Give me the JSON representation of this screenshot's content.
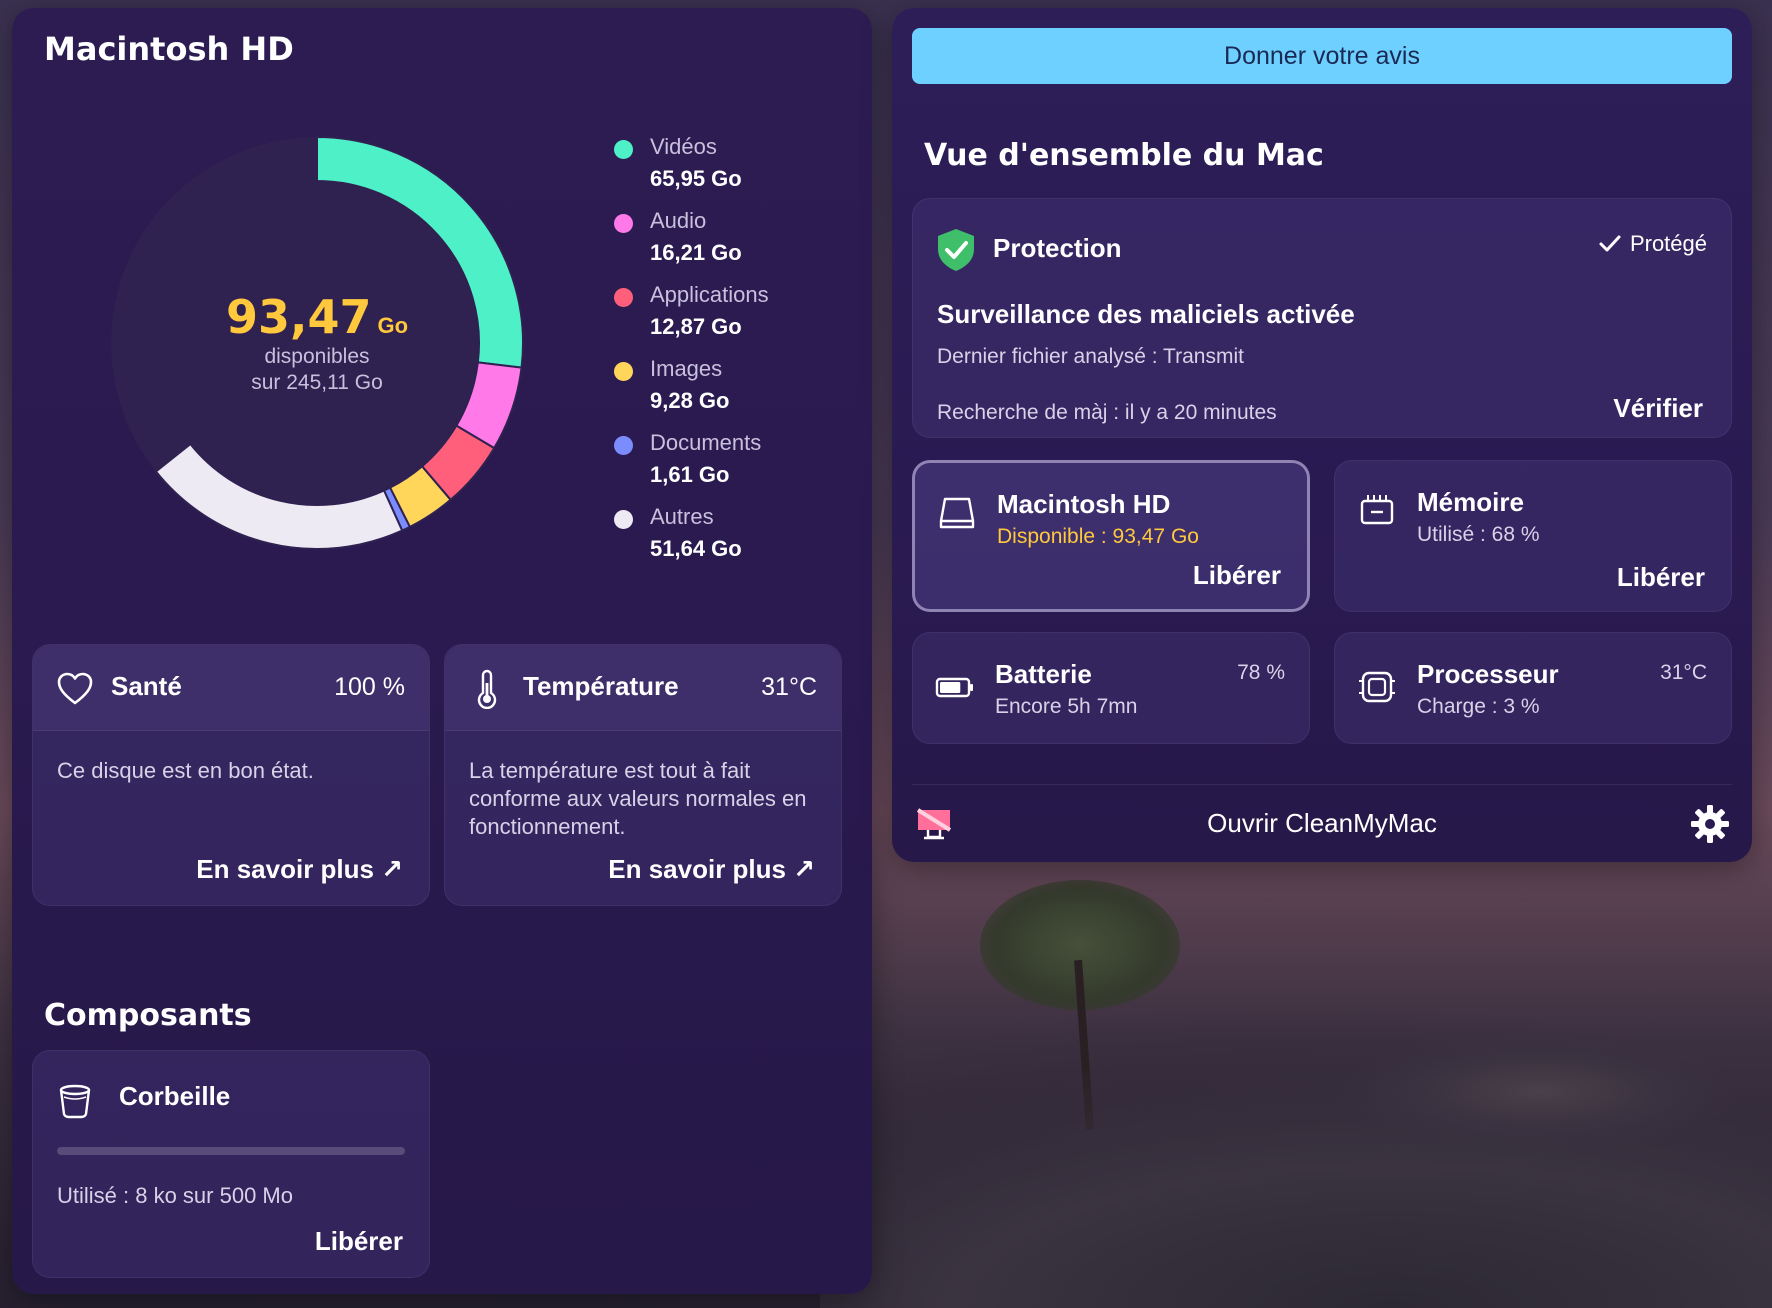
{
  "left": {
    "disk_title": "Macintosh HD",
    "donut": {
      "free_value": "93,47",
      "free_unit": "Go",
      "free_label": "disponibles",
      "total_label": "sur 245,11 Go",
      "total_gb": 245.11,
      "free_gb": 93.47
    },
    "legend": [
      {
        "name": "Vidéos",
        "size": "65,95 Go",
        "gb": 65.95,
        "color": "#4ef0c8"
      },
      {
        "name": "Audio",
        "size": "16,21 Go",
        "gb": 16.21,
        "color": "#ff7ae8"
      },
      {
        "name": "Applications",
        "size": "12,87 Go",
        "gb": 12.87,
        "color": "#ff5f7a"
      },
      {
        "name": "Images",
        "size": "9,28 Go",
        "gb": 9.28,
        "color": "#ffd65a"
      },
      {
        "name": "Documents",
        "size": "1,61 Go",
        "gb": 1.61,
        "color": "#7b8cff"
      },
      {
        "name": "Autres",
        "size": "51,64 Go",
        "gb": 51.64,
        "color": "#eeeaf4"
      }
    ],
    "health": {
      "title": "Santé",
      "value": "100 %",
      "text": "Ce disque est en bon état.",
      "link": "En savoir plus ↗"
    },
    "temperature": {
      "title": "Température",
      "value": "31°C",
      "text": "La température est tout à fait conforme aux valeurs normales en fonctionnement.",
      "link": "En savoir plus ↗"
    },
    "components_title": "Composants",
    "trash": {
      "title": "Corbeille",
      "used": "Utilisé : 8 ko sur 500 Mo",
      "used_fraction": 0.0,
      "button": "Libérer"
    }
  },
  "right": {
    "feedback": "Donner votre avis",
    "overview_title": "Vue d'ensemble du Mac",
    "protection": {
      "title": "Protection",
      "status": "Protégé",
      "heading": "Surveillance des maliciels activée",
      "last_file": "Dernier fichier analysé : Transmit",
      "update": "Recherche de màj : il y a 20 minutes",
      "verify": "Vérifier"
    },
    "disk": {
      "title": "Macintosh HD",
      "sub": "Disponible : 93,47 Go",
      "button": "Libérer",
      "accent": "#ffc83d"
    },
    "memory": {
      "title": "Mémoire",
      "sub": "Utilisé : 68 %",
      "button": "Libérer"
    },
    "battery": {
      "title": "Batterie",
      "sub": "Encore 5h 7mn",
      "value": "78 %",
      "level": 0.78
    },
    "cpu": {
      "title": "Processeur",
      "sub": "Charge : 3 %",
      "value": "31°C"
    },
    "open_app": "Ouvrir CleanMyMac"
  }
}
